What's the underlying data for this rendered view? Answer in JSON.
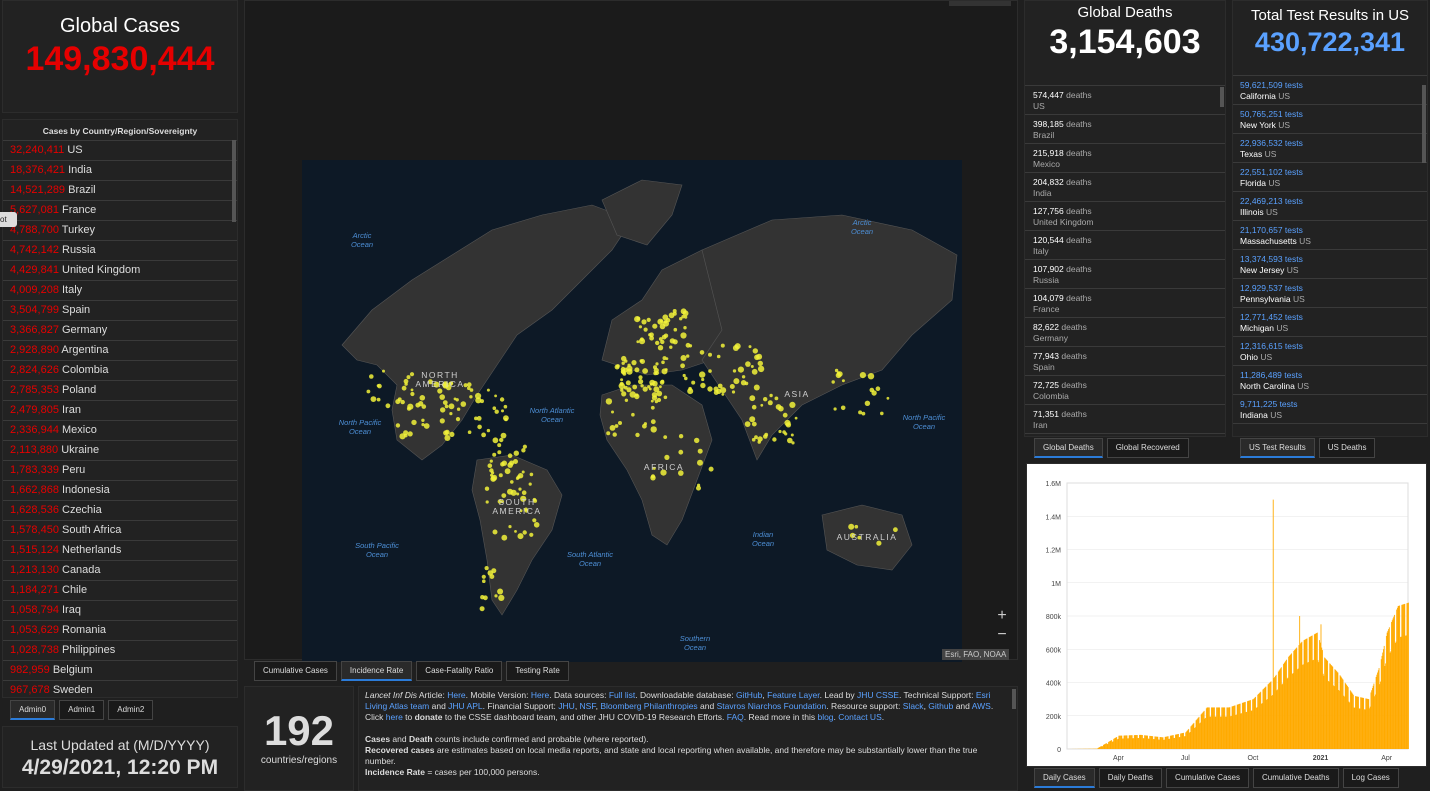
{
  "global_cases": {
    "title": "Global Cases",
    "value": "149,830,444"
  },
  "cases_list": {
    "title": "Cases by Country/Region/Sovereignty",
    "items": [
      {
        "num": "32,240,411",
        "name": "US"
      },
      {
        "num": "18,376,421",
        "name": "India"
      },
      {
        "num": "14,521,289",
        "name": "Brazil"
      },
      {
        "num": "5,627,081",
        "name": "France"
      },
      {
        "num": "4,788,700",
        "name": "Turkey"
      },
      {
        "num": "4,742,142",
        "name": "Russia"
      },
      {
        "num": "4,429,841",
        "name": "United Kingdom"
      },
      {
        "num": "4,009,208",
        "name": "Italy"
      },
      {
        "num": "3,504,799",
        "name": "Spain"
      },
      {
        "num": "3,366,827",
        "name": "Germany"
      },
      {
        "num": "2,928,890",
        "name": "Argentina"
      },
      {
        "num": "2,824,626",
        "name": "Colombia"
      },
      {
        "num": "2,785,353",
        "name": "Poland"
      },
      {
        "num": "2,479,805",
        "name": "Iran"
      },
      {
        "num": "2,336,944",
        "name": "Mexico"
      },
      {
        "num": "2,113,880",
        "name": "Ukraine"
      },
      {
        "num": "1,783,339",
        "name": "Peru"
      },
      {
        "num": "1,662,868",
        "name": "Indonesia"
      },
      {
        "num": "1,628,536",
        "name": "Czechia"
      },
      {
        "num": "1,578,450",
        "name": "South Africa"
      },
      {
        "num": "1,515,124",
        "name": "Netherlands"
      },
      {
        "num": "1,213,130",
        "name": "Canada"
      },
      {
        "num": "1,184,271",
        "name": "Chile"
      },
      {
        "num": "1,058,794",
        "name": "Iraq"
      },
      {
        "num": "1,053,629",
        "name": "Romania"
      },
      {
        "num": "1,028,738",
        "name": "Philippines"
      },
      {
        "num": "982,959",
        "name": "Belgium"
      },
      {
        "num": "967,678",
        "name": "Sweden"
      }
    ]
  },
  "side_tag": "ot",
  "admin_tabs": [
    "Admin0",
    "Admin1",
    "Admin2"
  ],
  "last_updated": {
    "label": "Last Updated at (M/D/YYYY)",
    "value": "4/29/2021, 12:20 PM"
  },
  "map": {
    "labels": {
      "arctic_l": "Arctic Ocean",
      "arctic_r": "Arctic Ocean",
      "north_america": "NORTH AMERICA",
      "north_pacific_l": "North Pacific Ocean",
      "north_atlantic": "North Atlantic Ocean",
      "africa": "AFRICA",
      "asia": "ASIA",
      "south_america": "SOUTH AMERICA",
      "south_pacific": "South Pacific Ocean",
      "south_atlantic": "South Atlantic Ocean",
      "indian": "Indian Ocean",
      "australia": "AUSTRALIA",
      "north_pacific_r": "North Pacific Ocean",
      "southern": "Southern Ocean"
    },
    "attribution": "Esri, FAO, NOAA",
    "zoom_in": "+",
    "zoom_out": "−"
  },
  "map_tabs": [
    "Cumulative Cases",
    "Incidence Rate",
    "Case-Fatality Ratio",
    "Testing Rate"
  ],
  "countries": {
    "value": "192",
    "label": "countries/regions"
  },
  "info": {
    "p1": [
      {
        "t": "Lancet Inf Dis",
        "s": "i"
      },
      {
        "t": " Article: ",
        "s": ""
      },
      {
        "t": "Here",
        "s": "l"
      },
      {
        "t": ". Mobile Version: ",
        "s": ""
      },
      {
        "t": "Here",
        "s": "l"
      },
      {
        "t": ". Data sources: ",
        "s": ""
      },
      {
        "t": "Full list",
        "s": "l"
      },
      {
        "t": ". Downloadable database: ",
        "s": ""
      },
      {
        "t": "GitHub",
        "s": "l"
      },
      {
        "t": ", ",
        "s": ""
      },
      {
        "t": "Feature Layer",
        "s": "l"
      },
      {
        "t": ". Lead by ",
        "s": ""
      },
      {
        "t": "JHU CSSE",
        "s": "l"
      },
      {
        "t": ". Technical Support: ",
        "s": ""
      },
      {
        "t": "Esri Living Atlas team",
        "s": "l"
      },
      {
        "t": " and ",
        "s": ""
      },
      {
        "t": "JHU APL",
        "s": "l"
      },
      {
        "t": ". Financial Support: ",
        "s": ""
      },
      {
        "t": "JHU",
        "s": "l"
      },
      {
        "t": ", ",
        "s": ""
      },
      {
        "t": "NSF",
        "s": "l"
      },
      {
        "t": ", ",
        "s": ""
      },
      {
        "t": "Bloomberg Philanthropies",
        "s": "l"
      },
      {
        "t": " and ",
        "s": ""
      },
      {
        "t": "Stavros Niarchos Foundation",
        "s": "l"
      },
      {
        "t": ". Resource support: ",
        "s": ""
      },
      {
        "t": "Slack",
        "s": "l"
      },
      {
        "t": ", ",
        "s": ""
      },
      {
        "t": "Github",
        "s": "l"
      },
      {
        "t": " and ",
        "s": ""
      },
      {
        "t": "AWS",
        "s": "l"
      },
      {
        "t": ". Click ",
        "s": ""
      },
      {
        "t": "here",
        "s": "l"
      },
      {
        "t": " to ",
        "s": ""
      },
      {
        "t": "donate",
        "s": "b"
      },
      {
        "t": " to the CSSE dashboard team, and other JHU COVID-19 Research Efforts. ",
        "s": ""
      },
      {
        "t": "FAQ",
        "s": "l"
      },
      {
        "t": ". Read more in this ",
        "s": ""
      },
      {
        "t": "blog",
        "s": "l"
      },
      {
        "t": ". ",
        "s": ""
      },
      {
        "t": "Contact US",
        "s": "l"
      },
      {
        "t": ".",
        "s": ""
      }
    ],
    "p2": [
      {
        "t": "Cases",
        "s": "b"
      },
      {
        "t": " and ",
        "s": ""
      },
      {
        "t": "Death",
        "s": "b"
      },
      {
        "t": " counts include confirmed and probable (where reported).",
        "s": ""
      }
    ],
    "p3": [
      {
        "t": "Recovered cases",
        "s": "b"
      },
      {
        "t": " are estimates based on local media reports, and state and local reporting when available, and therefore may be substantially lower than the true number.",
        "s": ""
      }
    ],
    "p4": [
      {
        "t": "Incidence Rate",
        "s": "b"
      },
      {
        "t": " = cases per 100,000 persons.",
        "s": ""
      }
    ]
  },
  "global_deaths": {
    "title": "Global Deaths",
    "value": "3,154,603",
    "items": [
      {
        "num": "574,447",
        "unit": "deaths",
        "name": "US"
      },
      {
        "num": "398,185",
        "unit": "deaths",
        "name": "Brazil"
      },
      {
        "num": "215,918",
        "unit": "deaths",
        "name": "Mexico"
      },
      {
        "num": "204,832",
        "unit": "deaths",
        "name": "India"
      },
      {
        "num": "127,756",
        "unit": "deaths",
        "name": "United Kingdom"
      },
      {
        "num": "120,544",
        "unit": "deaths",
        "name": "Italy"
      },
      {
        "num": "107,902",
        "unit": "deaths",
        "name": "Russia"
      },
      {
        "num": "104,079",
        "unit": "deaths",
        "name": "France"
      },
      {
        "num": "82,622",
        "unit": "deaths",
        "name": "Germany"
      },
      {
        "num": "77,943",
        "unit": "deaths",
        "name": "Spain"
      },
      {
        "num": "72,725",
        "unit": "deaths",
        "name": "Colombia"
      },
      {
        "num": "71,351",
        "unit": "deaths",
        "name": "Iran"
      }
    ],
    "tabs": [
      "Global Deaths",
      "Global Recovered"
    ]
  },
  "us_tests": {
    "title": "Total Test Results in US",
    "value": "430,722,341",
    "items": [
      {
        "num": "59,621,509",
        "unit": "tests",
        "name": "California",
        "country": "US"
      },
      {
        "num": "50,765,251",
        "unit": "tests",
        "name": "New York",
        "country": "US"
      },
      {
        "num": "22,936,532",
        "unit": "tests",
        "name": "Texas",
        "country": "US"
      },
      {
        "num": "22,551,102",
        "unit": "tests",
        "name": "Florida",
        "country": "US"
      },
      {
        "num": "22,469,213",
        "unit": "tests",
        "name": "Illinois",
        "country": "US"
      },
      {
        "num": "21,170,657",
        "unit": "tests",
        "name": "Massachusetts",
        "country": "US"
      },
      {
        "num": "13,374,593",
        "unit": "tests",
        "name": "New Jersey",
        "country": "US"
      },
      {
        "num": "12,929,537",
        "unit": "tests",
        "name": "Pennsylvania",
        "country": "US"
      },
      {
        "num": "12,771,452",
        "unit": "tests",
        "name": "Michigan",
        "country": "US"
      },
      {
        "num": "12,316,615",
        "unit": "tests",
        "name": "Ohio",
        "country": "US"
      },
      {
        "num": "11,286,489",
        "unit": "tests",
        "name": "North Carolina",
        "country": "US"
      },
      {
        "num": "9,711,225",
        "unit": "tests",
        "name": "Indiana",
        "country": "US"
      }
    ],
    "tabs": [
      "US Test Results",
      "US Deaths"
    ]
  },
  "chart_tabs": [
    "Daily Cases",
    "Daily Deaths",
    "Cumulative Cases",
    "Cumulative Deaths",
    "Log Cases"
  ],
  "chart_data": {
    "type": "bar",
    "title": "",
    "xlabel": "",
    "ylabel": "",
    "color": "#ffaa00",
    "ylim": [
      0,
      1600000
    ],
    "y_ticks": [
      "0",
      "200k",
      "400k",
      "600k",
      "800k",
      "1M",
      "1.2M",
      "1.4M",
      "1.6M"
    ],
    "y_tick_values": [
      0,
      200000,
      400000,
      600000,
      800000,
      1000000,
      1200000,
      1400000,
      1600000
    ],
    "x_ticks": [
      "Apr",
      "Jul",
      "Oct",
      "2021",
      "Apr"
    ],
    "x_tick_index": [
      70,
      161,
      253,
      345,
      435
    ],
    "anchors": [
      [
        0,
        0
      ],
      [
        40,
        2000
      ],
      [
        55,
        40000
      ],
      [
        70,
        80000
      ],
      [
        100,
        85000
      ],
      [
        130,
        70000
      ],
      [
        161,
        100000
      ],
      [
        190,
        250000
      ],
      [
        220,
        250000
      ],
      [
        253,
        300000
      ],
      [
        280,
        420000
      ],
      [
        300,
        550000
      ],
      [
        320,
        650000
      ],
      [
        340,
        700000
      ],
      [
        350,
        550000
      ],
      [
        370,
        450000
      ],
      [
        390,
        320000
      ],
      [
        410,
        300000
      ],
      [
        425,
        500000
      ],
      [
        435,
        700000
      ],
      [
        450,
        860000
      ],
      [
        464,
        880000
      ]
    ],
    "spikes": [
      [
        280,
        1500000
      ],
      [
        316,
        800000
      ],
      [
        345,
        750000
      ]
    ],
    "weekly_dip": 0.22,
    "n_days": 465
  }
}
